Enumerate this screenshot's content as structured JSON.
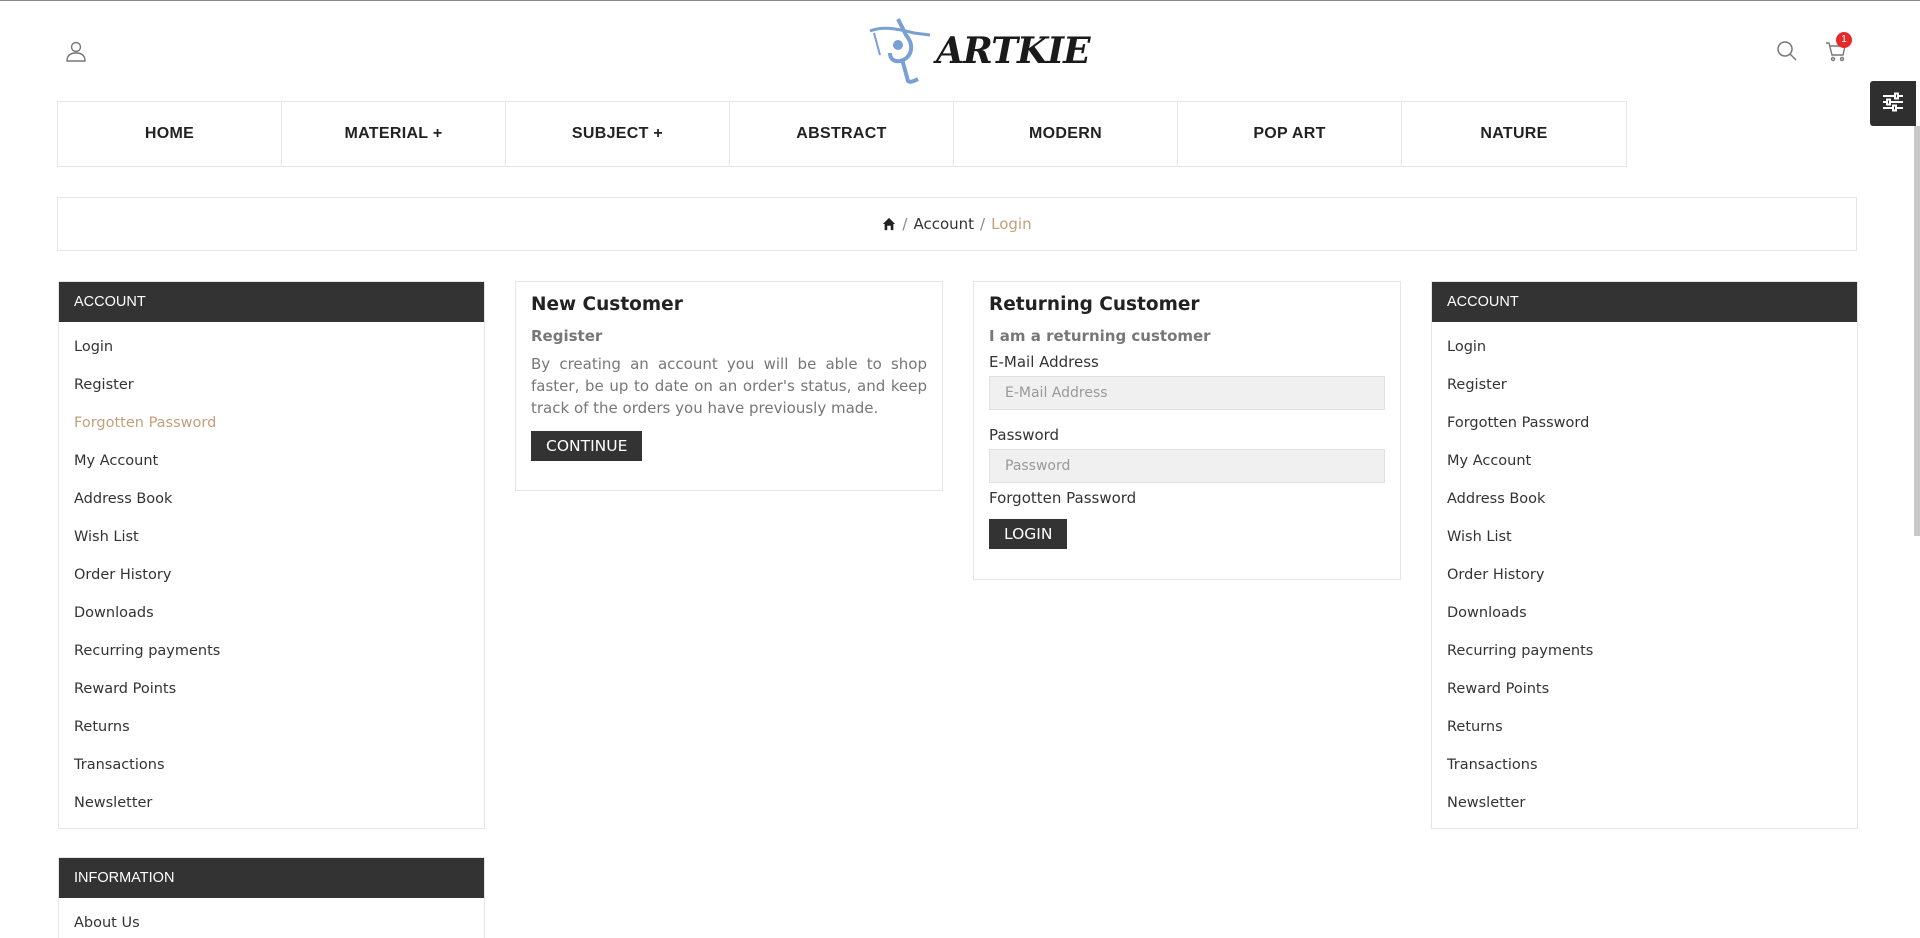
{
  "brand": {
    "logo_text": "ARTKIE",
    "logo_color": "#7a9fd4"
  },
  "header": {
    "cart_count": "1"
  },
  "nav": {
    "items": [
      {
        "label": "HOME"
      },
      {
        "label": "MATERIAL +"
      },
      {
        "label": "SUBJECT +"
      },
      {
        "label": "ABSTRACT"
      },
      {
        "label": "MODERN"
      },
      {
        "label": "POP ART"
      },
      {
        "label": "NATURE"
      }
    ]
  },
  "breadcrumb": {
    "account": "Account",
    "current": "Login",
    "separator": "/"
  },
  "left_account": {
    "heading": "ACCOUNT",
    "items": [
      "Login",
      "Register",
      "Forgotten Password",
      "My Account",
      "Address Book",
      "Wish List",
      "Order History",
      "Downloads",
      "Recurring payments",
      "Reward Points",
      "Returns",
      "Transactions",
      "Newsletter"
    ],
    "active_item": "Forgotten Password"
  },
  "information": {
    "heading": "INFORMATION",
    "items": [
      "About Us"
    ]
  },
  "new_customer": {
    "title": "New Customer",
    "subtitle": "Register",
    "description": "By creating an account you will be able to shop faster, be up to date on an order's status, and keep track of the orders you have previously made.",
    "button": "CONTINUE"
  },
  "returning_customer": {
    "title": "Returning Customer",
    "subtitle": "I am a returning customer",
    "email_label": "E-Mail Address",
    "email_placeholder": "E-Mail Address",
    "password_label": "Password",
    "password_placeholder": "Password",
    "forgot": "Forgotten Password",
    "button": "LOGIN"
  },
  "right_account": {
    "heading": "ACCOUNT",
    "items": [
      "Login",
      "Register",
      "Forgotten Password",
      "My Account",
      "Address Book",
      "Wish List",
      "Order History",
      "Downloads",
      "Recurring payments",
      "Reward Points",
      "Returns",
      "Transactions",
      "Newsletter"
    ]
  },
  "colors": {
    "accent": "#c2a07c",
    "dark": "#333333",
    "badge": "#e32b2b"
  }
}
